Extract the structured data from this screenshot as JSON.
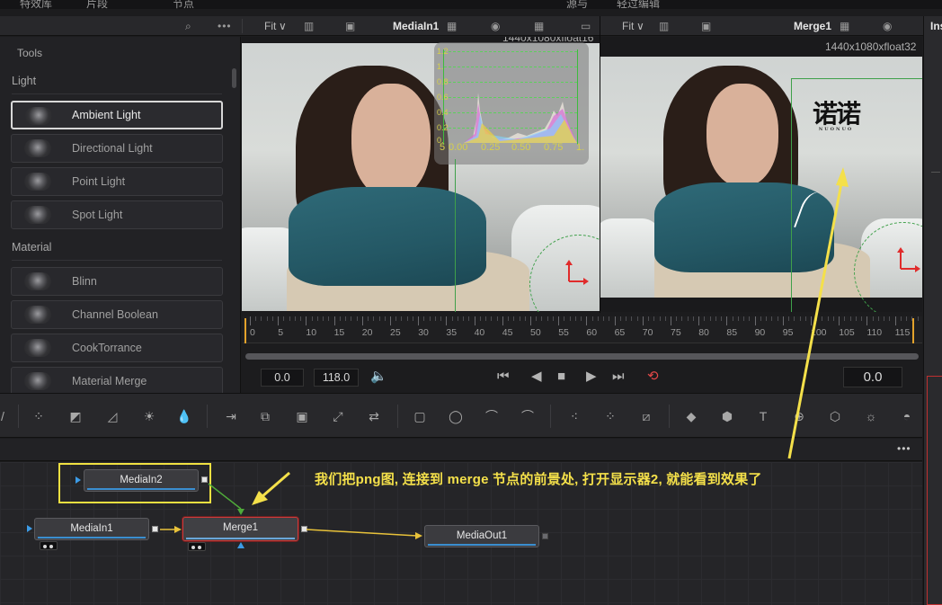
{
  "top_strip": {
    "left_text": "特效库",
    "tab2": "片段",
    "tab3": "节点",
    "mid_text": "源与",
    "right_text": "轻过编辑"
  },
  "viewer1": {
    "zoom": "Fit",
    "zoom_arrow": "∨",
    "node_name": "MediaIn1",
    "resolution": "1440x1080xfloat16"
  },
  "viewer2": {
    "zoom": "Fit",
    "zoom_arrow": "∨",
    "node_name": "Merge1",
    "resolution": "1440x1080xfloat32"
  },
  "right_panel": {
    "label": "Ins"
  },
  "tools_panel": {
    "title": "Tools",
    "sections": [
      {
        "label": "Light",
        "items": [
          "Ambient Light",
          "Directional Light",
          "Point Light",
          "Spot Light"
        ]
      },
      {
        "label": "Material",
        "items": [
          "Blinn",
          "Channel Boolean",
          "CookTorrance",
          "Material Merge"
        ]
      }
    ]
  },
  "histogram": {
    "y_labels": [
      "1.2",
      "1.",
      "0.8",
      "0.6",
      "0.4",
      "0.2",
      "0."
    ],
    "x_labels": [
      "0.00",
      "0.25",
      "0.50",
      "0.75",
      "1."
    ],
    "x_left": "5"
  },
  "watermark": {
    "text": "诺诺",
    "sub": "NUONUO"
  },
  "timeline": {
    "labels": [
      "0",
      "5",
      "10",
      "15",
      "20",
      "25",
      "30",
      "35",
      "40",
      "45",
      "50",
      "55",
      "60",
      "65",
      "70",
      "75",
      "80",
      "85",
      "90",
      "95",
      "100",
      "105",
      "110",
      "115"
    ],
    "start_field": "0.0",
    "end_field": "118.0",
    "current_time": "0.0"
  },
  "node_panel": {
    "more_icon": "•••"
  },
  "nodes": {
    "mediain2": "MediaIn2",
    "mediain1": "MediaIn1",
    "merge1": "Merge1",
    "mediaout1": "MediaOut1"
  },
  "annotation": "我们把png图, 连接到 merge 节点的前景处, 打开显示器2, 就能看到效果了",
  "colors": {
    "annotation": "#f4e04a",
    "merge_border": "#cc3b3b",
    "guide": "#3fa04a",
    "port_in": "#3c9be6"
  }
}
